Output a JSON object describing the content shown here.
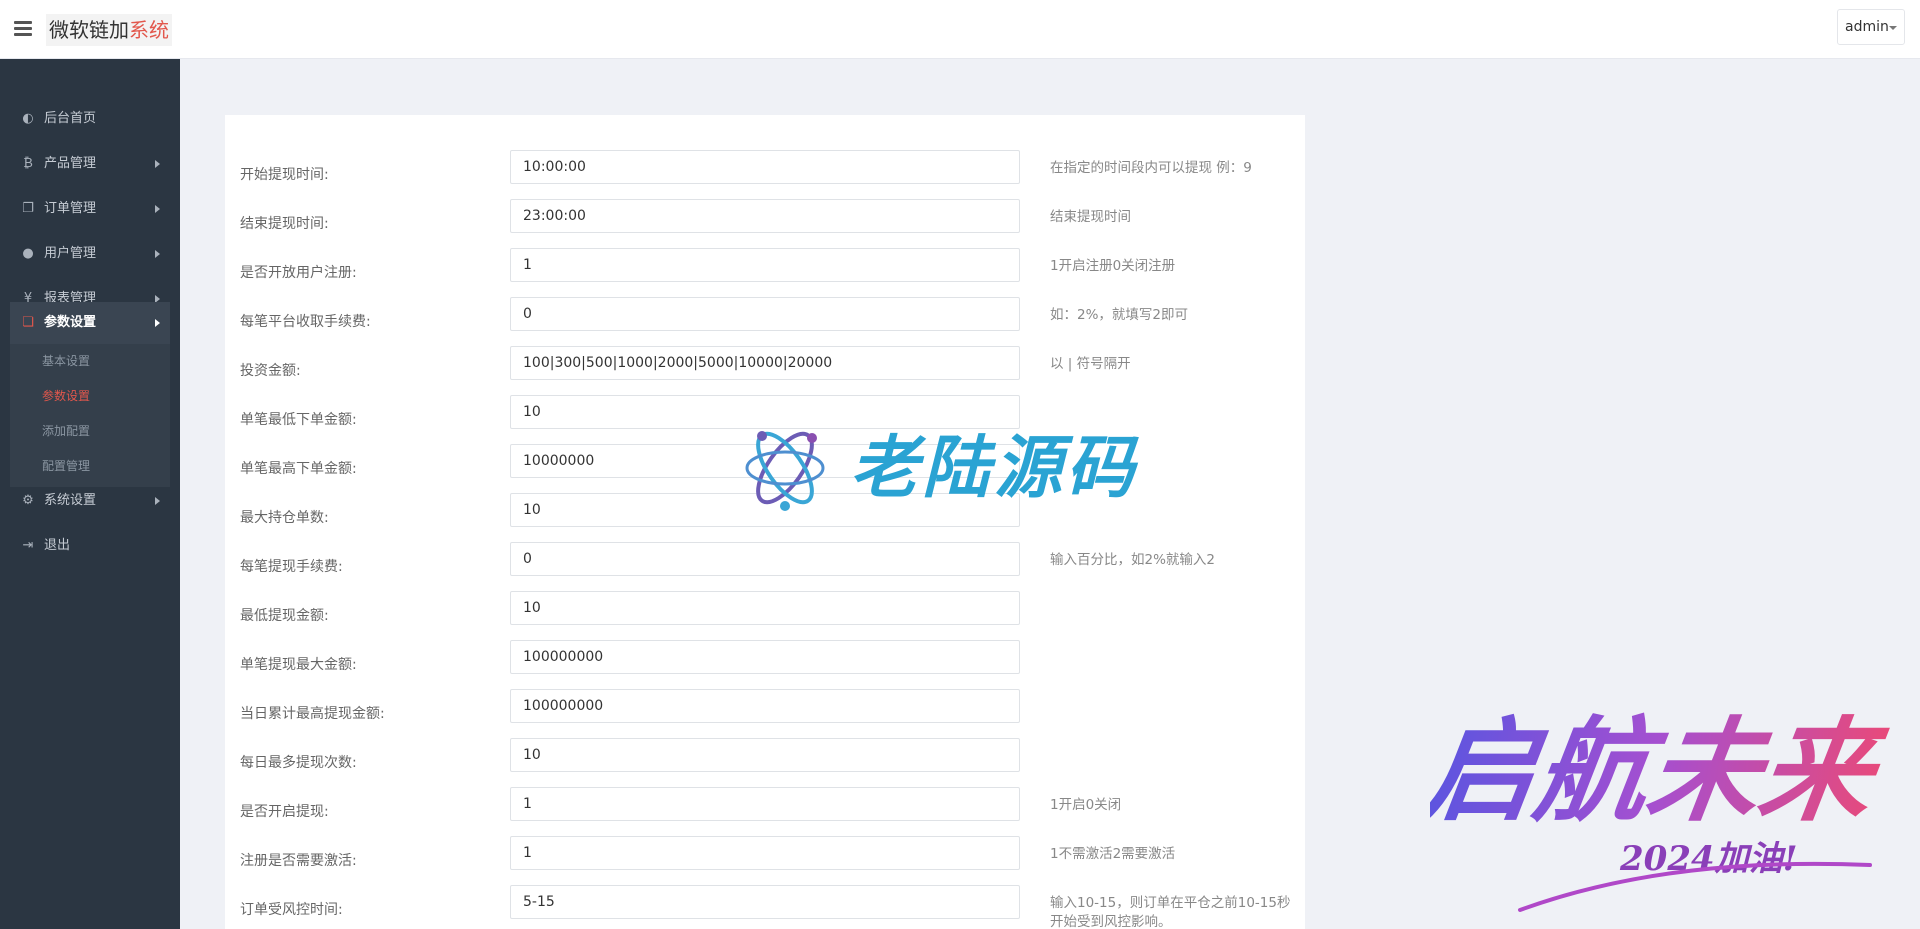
{
  "header": {
    "brand_main": "微软链加",
    "brand_accent": "系统",
    "user": "admin"
  },
  "colors": {
    "accent": "#e2574c",
    "sidebar_bg": "#2b3642",
    "watermark_blue": "#2aa3d3"
  },
  "sidebar": {
    "items": [
      {
        "label": "后台首页",
        "icon": "dashboard-icon"
      },
      {
        "label": "产品管理",
        "icon": "bitcoin-icon"
      },
      {
        "label": "订单管理",
        "icon": "copy-icon"
      },
      {
        "label": "用户管理",
        "icon": "user-icon"
      },
      {
        "label": "报表管理",
        "icon": "yen-icon"
      },
      {
        "label": "参数设置",
        "icon": "files-icon"
      },
      {
        "label": "系统设置",
        "icon": "gears-icon"
      },
      {
        "label": "退出",
        "icon": "sign-out-icon"
      }
    ],
    "submenu": [
      {
        "label": "基本设置"
      },
      {
        "label": "参数设置"
      },
      {
        "label": "添加配置"
      },
      {
        "label": "配置管理"
      }
    ]
  },
  "form": {
    "rows": [
      {
        "label": "开始提现时间:",
        "value": "10:00:00",
        "hint": "在指定的时间段内可以提现 例：9"
      },
      {
        "label": "结束提现时间:",
        "value": "23:00:00",
        "hint": "结束提现时间"
      },
      {
        "label": "是否开放用户注册:",
        "value": "1",
        "hint": "1开启注册0关闭注册"
      },
      {
        "label": "每笔平台收取手续费:",
        "value": "0",
        "hint": "如：2%，就填写2即可"
      },
      {
        "label": "投资金额:",
        "value": "100|300|500|1000|2000|5000|10000|20000",
        "hint": "以 | 符号隔开"
      },
      {
        "label": "单笔最低下单金额:",
        "value": "10",
        "hint": ""
      },
      {
        "label": "单笔最高下单金额:",
        "value": "10000000",
        "hint": ""
      },
      {
        "label": "最大持仓单数:",
        "value": "10",
        "hint": ""
      },
      {
        "label": "每笔提现手续费:",
        "value": "0",
        "hint": "输入百分比，如2%就输入2"
      },
      {
        "label": "最低提现金额:",
        "value": "10",
        "hint": ""
      },
      {
        "label": "单笔提现最大金额:",
        "value": "100000000",
        "hint": ""
      },
      {
        "label": "当日累计最高提现金额:",
        "value": "100000000",
        "hint": ""
      },
      {
        "label": "每日最多提现次数:",
        "value": "10",
        "hint": ""
      },
      {
        "label": "是否开启提现:",
        "value": "1",
        "hint": "1开启0关闭"
      },
      {
        "label": "注册是否需要激活:",
        "value": "1",
        "hint": "1不需激活2需要激活"
      },
      {
        "label": "订单受风控时间:",
        "value": "5-15",
        "hint": "输入10-15，则订单在平仓之前10-15秒开始受到风控影响。"
      }
    ]
  },
  "watermarks": {
    "logo_text": "老陆源码",
    "slogan_main": "启航未来",
    "slogan_sub": "2024加油!"
  }
}
